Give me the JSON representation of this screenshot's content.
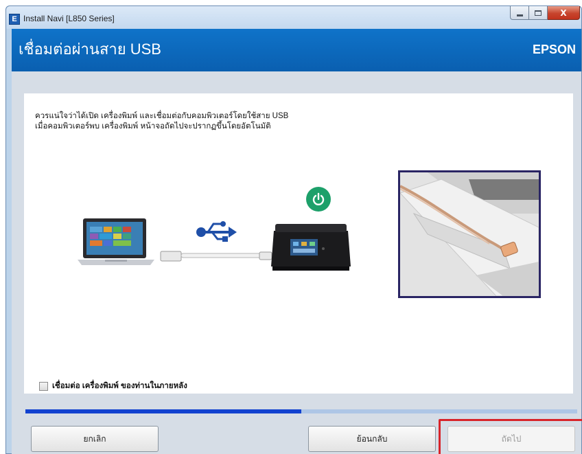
{
  "window": {
    "title": "Install Navi [L850 Series]",
    "app_icon_letter": "E",
    "close_glyph": "X"
  },
  "header": {
    "title": "เชื่อมต่อผ่านสาย USB",
    "brand": "EPSON"
  },
  "content": {
    "instruction_line1": "ควรแน่ใจว่าได้เปิด เครื่องพิมพ์ และเชื่อมต่อกับคอมพิวเตอร์โดยใช้สาย USB",
    "instruction_line2": "เมื่อคอมพิวเตอร์พบ เครื่องพิมพ์ หน้าจอถัดไปจะปรากฏขึ้นโดยอัตโนมัติ",
    "checkbox_label": "เชื่อมต่อ เครื่องพิมพ์ ของท่านในภายหลัง",
    "checkbox_checked": false
  },
  "progress": {
    "fraction": 0.5
  },
  "buttons": {
    "cancel": "ยกเลิก",
    "back": "ย้อนกลับ",
    "next": "ถัดไป"
  },
  "colors": {
    "header_blue": "#0a66bd",
    "power_green": "#1da06a",
    "progress_fill": "#1242d0",
    "highlight_red": "#d8242a"
  },
  "icons": {
    "usb": "usb-icon",
    "power": "power-icon",
    "app": "app-icon"
  }
}
